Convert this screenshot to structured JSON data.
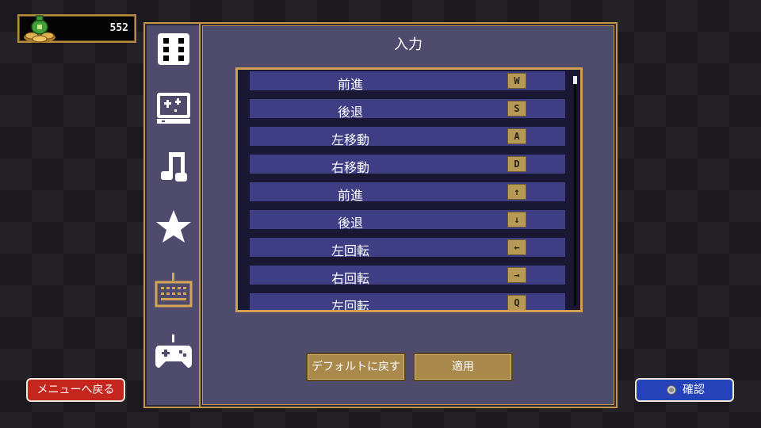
{
  "currency": {
    "amount": "552",
    "icon": "coin-bag-icon"
  },
  "sidebar": {
    "items": [
      {
        "name": "dice",
        "icon": "dice-icon",
        "selected": false
      },
      {
        "name": "display",
        "icon": "screen-sparkle-icon",
        "selected": false
      },
      {
        "name": "audio",
        "icon": "music-note-icon",
        "selected": false
      },
      {
        "name": "achievements",
        "icon": "star-icon",
        "selected": false
      },
      {
        "name": "keyboard",
        "icon": "keyboard-icon",
        "selected": true
      },
      {
        "name": "gamepad",
        "icon": "gamepad-icon",
        "selected": false
      }
    ]
  },
  "panel": {
    "title": "入力",
    "bindings": [
      {
        "action": "前進",
        "key": "W"
      },
      {
        "action": "後退",
        "key": "S"
      },
      {
        "action": "左移動",
        "key": "A"
      },
      {
        "action": "右移動",
        "key": "D"
      },
      {
        "action": "前進",
        "key": "↑"
      },
      {
        "action": "後退",
        "key": "↓"
      },
      {
        "action": "左回転",
        "key": "←"
      },
      {
        "action": "右回転",
        "key": "→"
      },
      {
        "action": "左回転",
        "key": "Q"
      }
    ],
    "default_label": "デフォルトに戻す",
    "apply_label": "適用"
  },
  "footer": {
    "back_label": "メニューへ戻る",
    "confirm_label": "確認"
  },
  "colors": {
    "accent_gold": "#c3964a",
    "panel_bg": "#4e4b6c",
    "row_bg": "#3f3e85",
    "back_red": "#c4251c",
    "confirm_blue": "#2642b8"
  }
}
